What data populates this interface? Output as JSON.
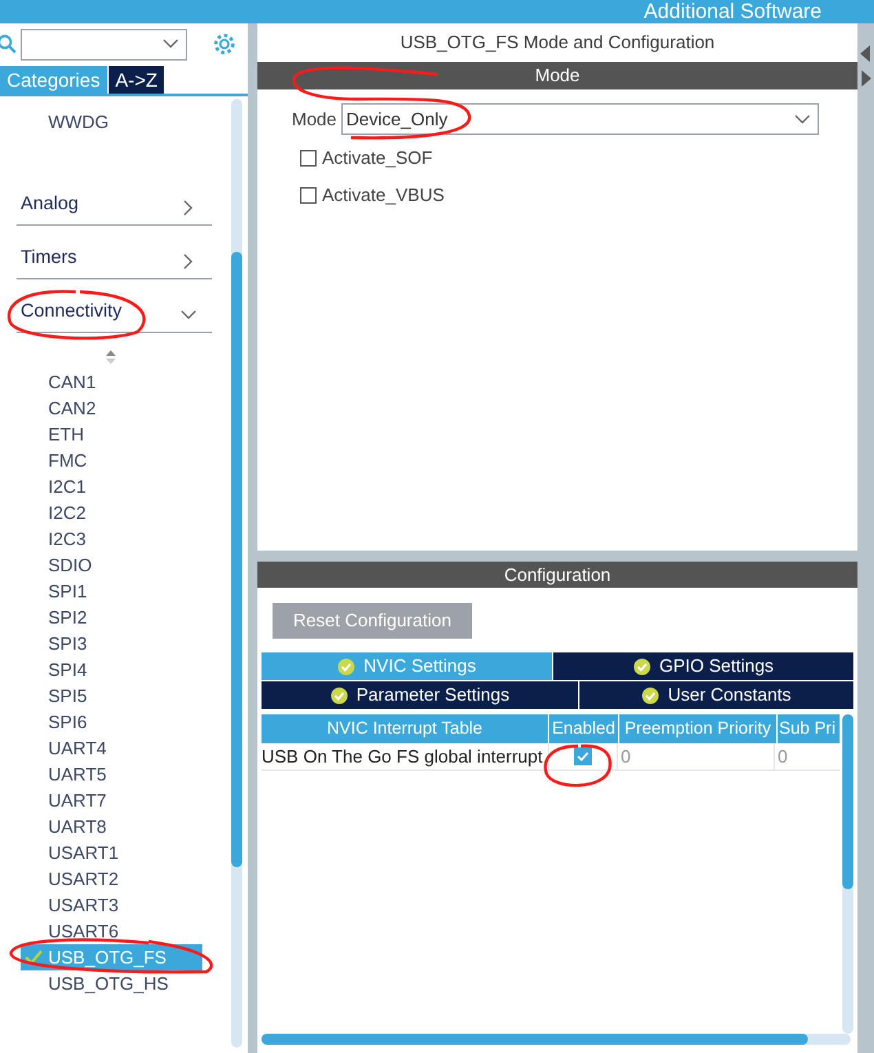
{
  "header": {
    "title": "Additional Software"
  },
  "sidebar": {
    "tabs": [
      {
        "label": "Categories",
        "selected": true
      },
      {
        "label": "A->Z",
        "selected": false
      }
    ],
    "items_above": [
      {
        "label": "WWDG"
      }
    ],
    "categories": [
      {
        "label": "Analog",
        "expanded": false
      },
      {
        "label": "Timers",
        "expanded": false
      },
      {
        "label": "Connectivity",
        "expanded": true
      }
    ],
    "connectivity_items": [
      {
        "label": "CAN1",
        "selected": false,
        "checked": false
      },
      {
        "label": "CAN2",
        "selected": false,
        "checked": false
      },
      {
        "label": "ETH",
        "selected": false,
        "checked": false
      },
      {
        "label": "FMC",
        "selected": false,
        "checked": false
      },
      {
        "label": "I2C1",
        "selected": false,
        "checked": false
      },
      {
        "label": "I2C2",
        "selected": false,
        "checked": false
      },
      {
        "label": "I2C3",
        "selected": false,
        "checked": false
      },
      {
        "label": "SDIO",
        "selected": false,
        "checked": false
      },
      {
        "label": "SPI1",
        "selected": false,
        "checked": false
      },
      {
        "label": "SPI2",
        "selected": false,
        "checked": false
      },
      {
        "label": "SPI3",
        "selected": false,
        "checked": false
      },
      {
        "label": "SPI4",
        "selected": false,
        "checked": false
      },
      {
        "label": "SPI5",
        "selected": false,
        "checked": false
      },
      {
        "label": "SPI6",
        "selected": false,
        "checked": false
      },
      {
        "label": "UART4",
        "selected": false,
        "checked": false
      },
      {
        "label": "UART5",
        "selected": false,
        "checked": false
      },
      {
        "label": "UART7",
        "selected": false,
        "checked": false
      },
      {
        "label": "UART8",
        "selected": false,
        "checked": false
      },
      {
        "label": "USART1",
        "selected": false,
        "checked": false
      },
      {
        "label": "USART2",
        "selected": false,
        "checked": false
      },
      {
        "label": "USART3",
        "selected": false,
        "checked": false
      },
      {
        "label": "USART6",
        "selected": false,
        "checked": false
      },
      {
        "label": "USB_OTG_FS",
        "selected": true,
        "checked": true
      },
      {
        "label": "USB_OTG_HS",
        "selected": false,
        "checked": false
      }
    ]
  },
  "panel": {
    "title": "USB_OTG_FS Mode and Configuration",
    "mode": {
      "header": "Mode",
      "label": "Mode",
      "value": "Device_Only",
      "options": [
        {
          "label": "Activate_SOF",
          "checked": false
        },
        {
          "label": "Activate_VBUS",
          "checked": false
        }
      ]
    },
    "configuration": {
      "header": "Configuration",
      "reset_button": "Reset Configuration",
      "tab_rows": [
        [
          {
            "label": "NVIC Settings",
            "selected": true
          },
          {
            "label": "GPIO Settings",
            "selected": false
          }
        ],
        [
          {
            "label": "Parameter Settings",
            "selected": false
          },
          {
            "label": "User Constants",
            "selected": false
          }
        ]
      ],
      "table": {
        "columns": [
          "NVIC Interrupt Table",
          "Enabled",
          "Preemption Priority",
          "Sub Pri"
        ],
        "rows": [
          {
            "name": "USB On The Go FS global interrupt",
            "enabled": true,
            "preemption_priority": "0",
            "sub_priority": "0"
          }
        ]
      }
    }
  }
}
